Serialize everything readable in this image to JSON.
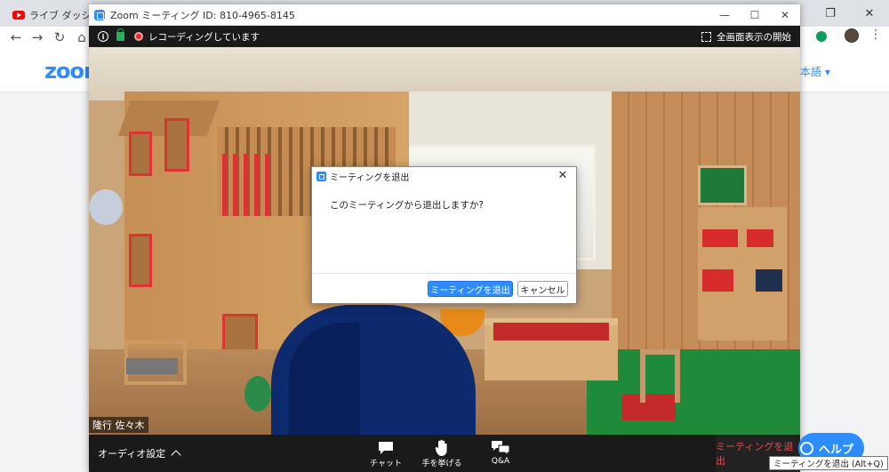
{
  "browser": {
    "tab_title": "ライブ ダッシュボード",
    "minimize": "—",
    "restore": "❐",
    "close": "✕"
  },
  "page": {
    "logo": "zoom",
    "language": "本語 ▾"
  },
  "zoom_window": {
    "title": "Zoom ミーティング ID: 810-4965-8145",
    "recording_text": "レコーディングしています",
    "fullscreen_label": "全画面表示の開始",
    "participant_name": "隆行 佐々木"
  },
  "dialog": {
    "title": "ミーティングを退出",
    "message": "このミーティングから退出しますか?",
    "leave_button": "ミーティングを退出",
    "cancel_button": "キャンセル"
  },
  "toolbar": {
    "audio_settings": "オーディオ設定",
    "chat": "チャット",
    "raise_hand": "手を挙げる",
    "qa": "Q&A",
    "leave": "ミーティングを退出"
  },
  "help": {
    "label": "ヘルプ",
    "tooltip": "ミーティングを退出 (Alt+Q)"
  },
  "colors": {
    "zoom_blue": "#2d8cff",
    "toolbar_bg": "#1a1a1a",
    "leave_red": "#e74c4c"
  }
}
